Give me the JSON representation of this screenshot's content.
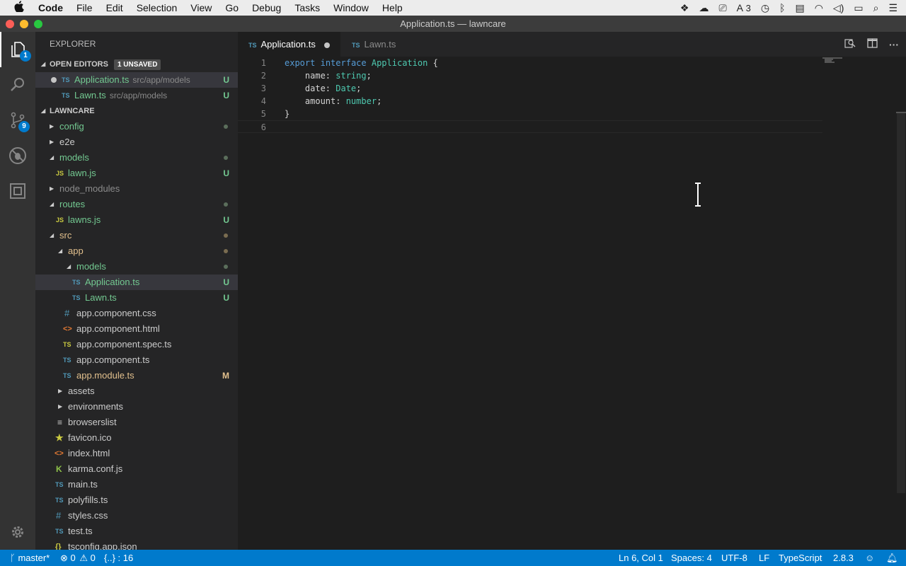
{
  "menubar": {
    "app_name": "Code",
    "items": [
      "File",
      "Edit",
      "Selection",
      "View",
      "Go",
      "Debug",
      "Tasks",
      "Window",
      "Help"
    ],
    "adobe_count": "3"
  },
  "window": {
    "title": "Application.ts — lawncare"
  },
  "activity": {
    "explorer_badge": "1",
    "scm_badge": "9"
  },
  "sidebar": {
    "title": "EXPLORER",
    "open_editors": {
      "header": "OPEN EDITORS",
      "unsaved_label": "1 UNSAVED",
      "items": [
        {
          "icon": "TS",
          "name": "Application.ts",
          "path": "src/app/models",
          "status": "U"
        },
        {
          "icon": "TS",
          "name": "Lawn.ts",
          "path": "src/app/models",
          "status": "U"
        }
      ]
    },
    "project": {
      "header": "LAWNCARE",
      "items": [
        {
          "name": "config",
          "status": ""
        },
        {
          "name": "e2e",
          "status": ""
        },
        {
          "name": "models",
          "status": ""
        },
        {
          "icon": "JS",
          "name": "lawn.js",
          "status": "U"
        },
        {
          "name": "node_modules",
          "status": ""
        },
        {
          "name": "routes",
          "status": ""
        },
        {
          "icon": "JS",
          "name": "lawns.js",
          "status": "U"
        },
        {
          "name": "src",
          "status": ""
        },
        {
          "name": "app",
          "status": ""
        },
        {
          "name": "models",
          "status": ""
        },
        {
          "icon": "TS",
          "name": "Application.ts",
          "status": "U"
        },
        {
          "icon": "TS",
          "name": "Lawn.ts",
          "status": "U"
        },
        {
          "icon": "#",
          "name": "app.component.css",
          "status": ""
        },
        {
          "icon": "<>",
          "name": "app.component.html",
          "status": ""
        },
        {
          "icon": "TS",
          "name": "app.component.spec.ts",
          "status": ""
        },
        {
          "icon": "TS",
          "name": "app.component.ts",
          "status": ""
        },
        {
          "icon": "TS",
          "name": "app.module.ts",
          "status": "M"
        },
        {
          "name": "assets",
          "status": ""
        },
        {
          "name": "environments",
          "status": ""
        },
        {
          "icon": "≡",
          "name": "browserslist",
          "status": ""
        },
        {
          "icon": "★",
          "name": "favicon.ico",
          "status": ""
        },
        {
          "icon": "<>",
          "name": "index.html",
          "status": ""
        },
        {
          "icon": "K",
          "name": "karma.conf.js",
          "status": ""
        },
        {
          "icon": "TS",
          "name": "main.ts",
          "status": ""
        },
        {
          "icon": "TS",
          "name": "polyfills.ts",
          "status": ""
        },
        {
          "icon": "#",
          "name": "styles.css",
          "status": ""
        },
        {
          "icon": "TS",
          "name": "test.ts",
          "status": ""
        },
        {
          "icon": "{}",
          "name": "tsconfig.app.json",
          "status": ""
        }
      ]
    }
  },
  "tabs": [
    {
      "icon": "TS",
      "label": "Application.ts"
    },
    {
      "icon": "TS",
      "label": "Lawn.ts"
    }
  ],
  "editor": {
    "lines": [
      {
        "num": "1"
      },
      {
        "num": "2"
      },
      {
        "num": "3"
      },
      {
        "num": "4"
      },
      {
        "num": "5"
      },
      {
        "num": "6"
      }
    ],
    "tokens": {
      "export": "export",
      "interface": "interface",
      "iface_name": "Application",
      "open_brace": " {",
      "name_field": "    name: ",
      "name_type": "string",
      "date_field": "    date: ",
      "date_type": "Date",
      "amount_field": "    amount: ",
      "amount_type": "number",
      "semi": ";",
      "close_brace": "}"
    }
  },
  "status": {
    "branch": "master*",
    "errors": "0",
    "warnings": "0",
    "symbols": "{..} : 16",
    "position": "Ln 6, Col 1",
    "spaces": "Spaces: 4",
    "encoding": "UTF-8",
    "eol": "LF",
    "language": "TypeScript",
    "ts_version": "2.8.3"
  }
}
